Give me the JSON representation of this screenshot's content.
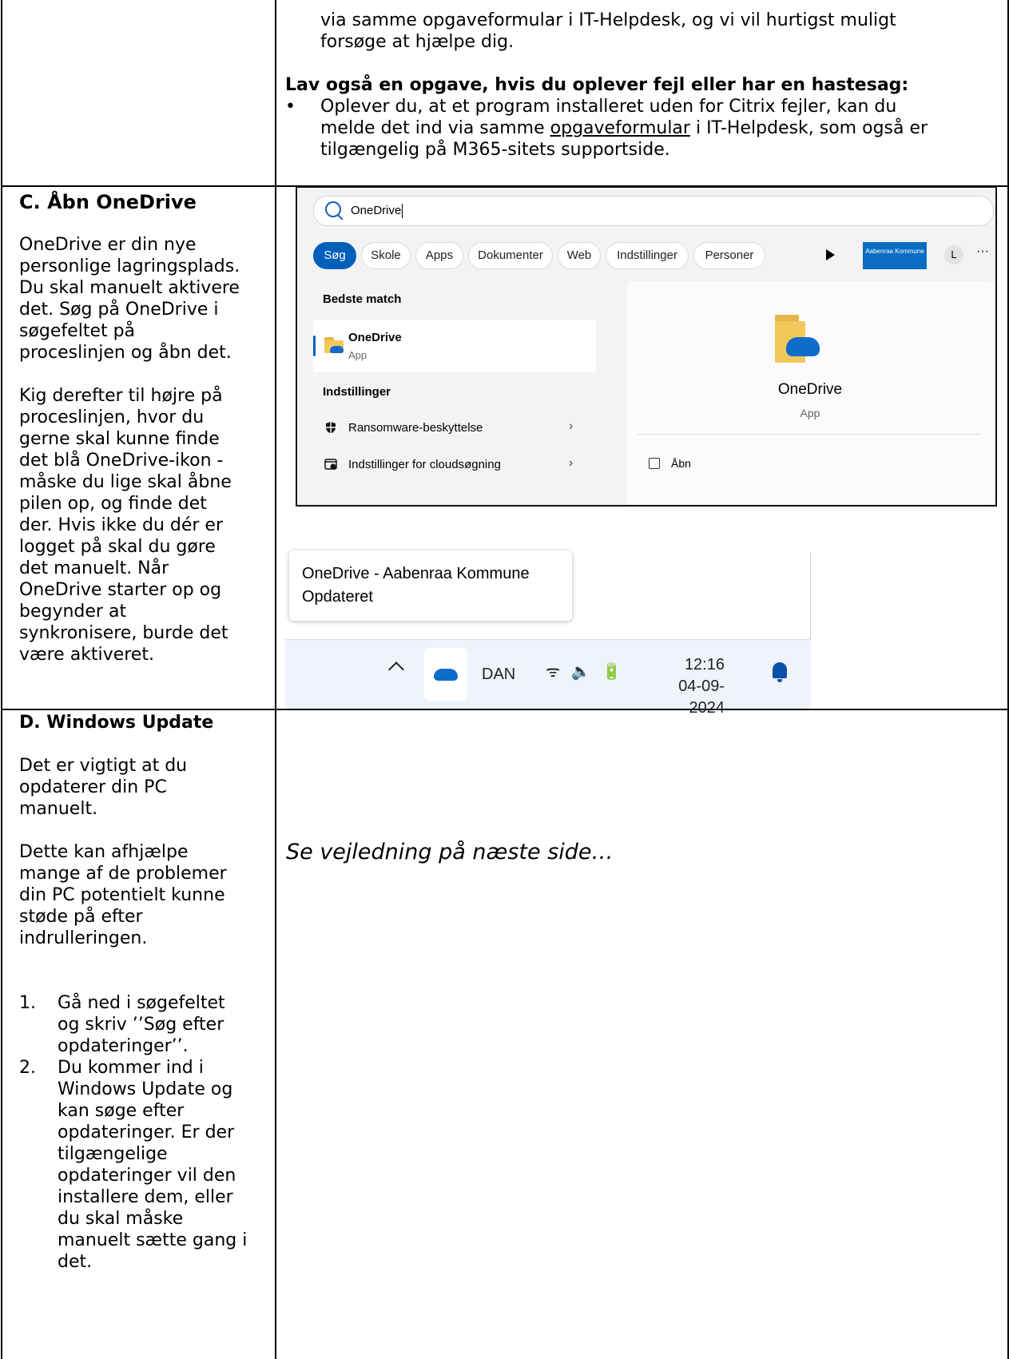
{
  "top_right": {
    "line1": "via samme opgaveformular i IT-Helpdesk, og vi vil hurtigst muligt",
    "line2": "forsøge at hjælpe dig.",
    "heading": "Lav også en opgave, hvis du oplever fejl eller har en hastesag:",
    "bullet": "•",
    "b1": "Oplever du, at et program installeret uden for Citrix fejler, kan du",
    "b2a": "melde det ind via samme ",
    "b2link": "opgaveformular",
    "b2b": " i IT-Helpdesk, som også er",
    "b3": "tilgængelig på M365-sitets supportside."
  },
  "section_c": {
    "title": "C.  Åbn OneDrive",
    "p1": [
      "OneDrive er din nye",
      "personlige lagringsplads.",
      "Du skal manuelt aktivere",
      "det. Søg på OneDrive i",
      "søgefeltet på",
      "proceslinjen og åbn det."
    ],
    "p2": [
      "Kig derefter til højre på",
      "proceslinjen, hvor du",
      "gerne skal kunne finde",
      "det blå OneDrive-ikon -",
      "måske du lige skal åbne",
      "pilen op, og finde det",
      "der. Hvis ikke du dér er",
      "logget på skal du gøre",
      "det manuelt. Når",
      "OneDrive starter op og",
      "begynder at",
      "synkronisere, burde det",
      "være aktiveret."
    ]
  },
  "search_shot": {
    "query": "OneDrive",
    "tabs": [
      "Søg",
      "Skole",
      "Apps",
      "Dokumenter",
      "Web",
      "Indstillinger",
      "Personer"
    ],
    "org_label": "Aabenraa Kommune",
    "avatar": "L",
    "more": "···",
    "best_match_label": "Bedste match",
    "best_title": "OneDrive",
    "best_sub": "App",
    "settings_label": "Indstillinger",
    "settings_items": [
      "Ransomware-beskyttelse",
      "Indstillinger for cloudsøgning"
    ],
    "chevron": "›",
    "detail_name": "OneDrive",
    "detail_sub": "App",
    "open_label": "Åbn"
  },
  "taskbar_shot": {
    "tooltip_line1": "OneDrive - Aabenraa Kommune",
    "tooltip_line2": "Opdateret",
    "lang": "DAN",
    "sys_icons": "ᯤ 🔈 🔋",
    "time": "12:16",
    "date": "04-09-2024"
  },
  "section_d": {
    "title": "D.  Windows Update",
    "p1": [
      "Det er vigtigt at du",
      "opdaterer din PC",
      "manuelt."
    ],
    "p2": [
      "Dette kan afhjælpe",
      "mange af de problemer",
      "din PC potentielt kunne",
      "støde på efter",
      "indrulleringen."
    ],
    "step1_num": "1.",
    "step1": [
      "Gå ned i søgefeltet",
      "og skriv ’’Søg efter",
      "opdateringer’’."
    ],
    "step2_num": "2.",
    "step2": [
      "Du kommer ind i",
      "Windows Update og",
      "kan søge efter",
      "opdateringer. Er der",
      "tilgængelige",
      "opdateringer vil den",
      "installere dem, eller",
      "du skal måske",
      "manuelt sætte gang i",
      "det."
    ],
    "see_next": "Se vejledning på næste side…"
  }
}
